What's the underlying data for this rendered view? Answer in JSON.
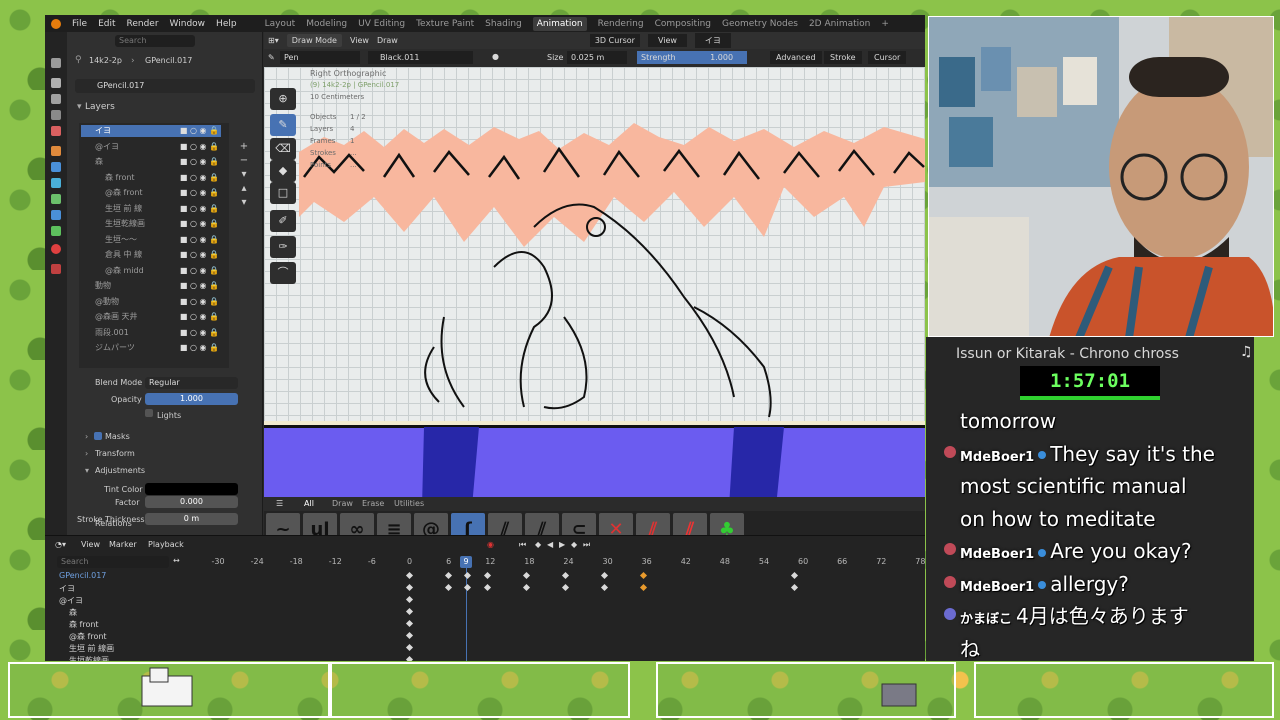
{
  "menubar": {
    "menus": [
      "File",
      "Edit",
      "Render",
      "Window",
      "Help"
    ],
    "workspaces": [
      "Layout",
      "Modeling",
      "UV Editing",
      "Texture Paint",
      "Shading",
      "Animation",
      "Rendering",
      "Compositing",
      "Geometry Nodes",
      "2D Animation"
    ],
    "active_workspace": "Animation",
    "add": "+"
  },
  "properties": {
    "search_placeholder": "Search",
    "breadcrumb_scene": "14k2-2p",
    "breadcrumb_object": "GPencil.017",
    "datablock": "GPencil.017",
    "layers_title": "Layers",
    "layers": [
      {
        "name": "イヨ",
        "active": true
      },
      {
        "name": "@イヨ",
        "active": false
      },
      {
        "name": "森",
        "active": false
      },
      {
        "name": "森 front",
        "active": false
      },
      {
        "name": "@森 front",
        "active": false
      },
      {
        "name": "生垣 前 線",
        "active": false
      },
      {
        "name": "生垣乾線画",
        "active": false
      },
      {
        "name": "生垣〜〜",
        "active": false
      },
      {
        "name": "倉具 中 線",
        "active": false
      },
      {
        "name": "@森 midd",
        "active": false
      },
      {
        "name": "動物",
        "active": false
      },
      {
        "name": "@動物",
        "active": false
      },
      {
        "name": "@森画 天井",
        "active": false
      },
      {
        "name": "雨段.001",
        "active": false
      },
      {
        "name": "ジムパーツ",
        "active": false
      }
    ],
    "blend_mode_label": "Blend Mode",
    "blend_mode_value": "Regular",
    "opacity_label": "Opacity",
    "opacity_value": "1.000",
    "lights_label": "Lights",
    "masks_label": "Masks",
    "transform_label": "Transform",
    "adjustments_label": "Adjustments",
    "tint_color_label": "Tint Color",
    "factor_label": "Factor",
    "factor_value": "0.000",
    "stroke_thickness_label": "Stroke Thickness",
    "stroke_thickness_value": "0 m",
    "relations_label": "Relations"
  },
  "viewport": {
    "mode": "Draw Mode",
    "view_menu": "View",
    "draw_menu": "Draw",
    "cursor_option": "3D Cursor",
    "view_option": "View",
    "layer_option": "イヨ",
    "tool_name": "Pen",
    "material": "Black.011",
    "size_label": "Size",
    "size_value": "0.025 m",
    "strength_label": "Strength",
    "strength_value": "1.000",
    "advanced": "Advanced",
    "stroke": "Stroke",
    "cursor": "Cursor",
    "overlay_view": "Right Orthographic",
    "overlay_object": "(9) 14k2-2p | GPencil.017",
    "overlay_scale": "10 Centimeters",
    "overlay_stats": [
      {
        "label": "Objects",
        "value": "1 / 2"
      },
      {
        "label": "Layers",
        "value": "4"
      },
      {
        "label": "Frames",
        "value": "1"
      },
      {
        "label": "Strokes",
        "value": "..."
      },
      {
        "label": "Points",
        "value": "..."
      }
    ],
    "brush_tabs": [
      "All",
      "Draw",
      "Erase",
      "Utilities"
    ],
    "brush_tab_active": "All"
  },
  "timeline": {
    "menus": [
      "View",
      "Marker",
      "Playback"
    ],
    "search_placeholder": "Search",
    "current_frame": "9",
    "frames": [
      "-30",
      "-24",
      "-18",
      "-12",
      "-6",
      "0",
      "6",
      "12",
      "18",
      "24",
      "30",
      "36",
      "42",
      "48",
      "54",
      "60",
      "66",
      "72",
      "78"
    ],
    "channels": [
      "GPencil.017",
      "イヨ",
      "@イヨ",
      "森",
      "森 front",
      "@森 front",
      "生垣 前 線画",
      "生垣乾線画"
    ]
  },
  "stream": {
    "title": "Issun or Kitarak - Chrono chross",
    "timer": "1:57:01",
    "chat": [
      {
        "user": "",
        "text": "tomorrow",
        "badge": false,
        "dot": "none"
      },
      {
        "user": "MdeBoer1",
        "text": "They say it's the",
        "badge": true,
        "dot": "red"
      },
      {
        "user": "",
        "text": "most scientific manual",
        "badge": false,
        "dot": "none"
      },
      {
        "user": "",
        "text": "on how to meditate",
        "badge": false,
        "dot": "none"
      },
      {
        "user": "MdeBoer1",
        "text": "Are you okay?",
        "badge": true,
        "dot": "red"
      },
      {
        "user": "MdeBoer1",
        "text": "allergy?",
        "badge": true,
        "dot": "red"
      },
      {
        "user": "かまぼこ",
        "text": "4月は色々あります",
        "badge": false,
        "dot": "blue"
      },
      {
        "user": "",
        "text": "ね",
        "badge": false,
        "dot": "none"
      }
    ]
  },
  "colors": {
    "accent": "#4772b3",
    "blender_bg": "#2b2b2b",
    "timer_green": "#6cff5f",
    "floor_blue": "#6b5cf0"
  }
}
